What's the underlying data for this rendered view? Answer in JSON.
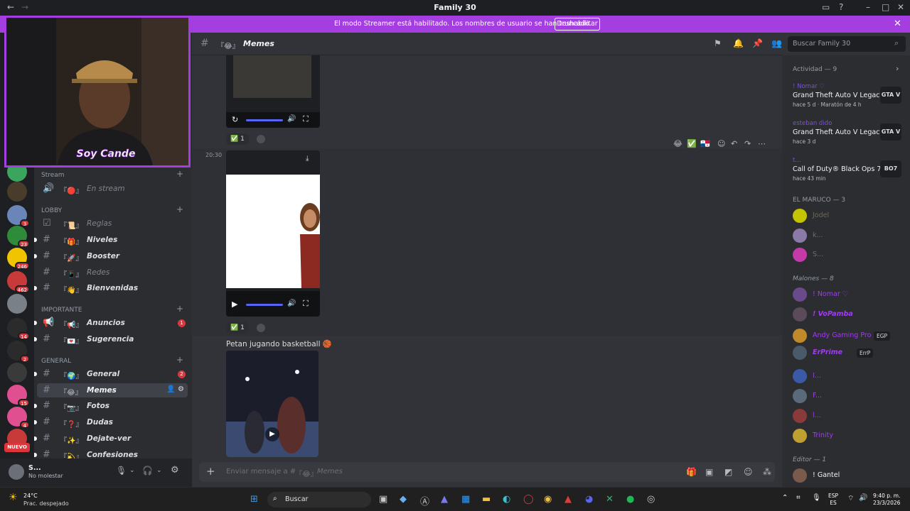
{
  "window": {
    "title": "Family 30"
  },
  "banner": {
    "message": "El modo Streamer está habilitado. Los nombres de usuario se han truncado.",
    "button": "Deshabilitar"
  },
  "server_badges": [
    "3",
    "23",
    "246",
    "462",
    "14",
    "2",
    "15",
    "4"
  ],
  "new_label": "NUEVO",
  "sidebar": {
    "categories": {
      "stream": "Stream",
      "lobby": "LOBBY",
      "importante": "IMPORTANTE",
      "general": "GENERAL"
    },
    "channels": [
      {
        "emoji": "『🔴』",
        "name": "En stream",
        "muted": true,
        "unread": ""
      },
      {
        "emoji": "『📜』",
        "name": "Reglas",
        "muted": true,
        "unread": ""
      },
      {
        "emoji": "『🎁』",
        "name": "Niveles",
        "muted": false,
        "unread": ""
      },
      {
        "emoji": "『🚀』",
        "name": "Booster",
        "muted": false,
        "unread": ""
      },
      {
        "emoji": "『📱』",
        "name": "Redes",
        "muted": true,
        "unread": ""
      },
      {
        "emoji": "『👋』",
        "name": "Bienvenidas",
        "muted": false,
        "unread": ""
      },
      {
        "emoji": "『📢』",
        "name": "Anuncios",
        "muted": false,
        "unread": "1"
      },
      {
        "emoji": "『💌』",
        "name": "Sugerencia",
        "muted": false,
        "unread": ""
      },
      {
        "emoji": "『🌍』",
        "name": "General",
        "muted": false,
        "unread": "2"
      },
      {
        "emoji": "『😂』",
        "name": "Memes",
        "muted": false,
        "unread": ""
      },
      {
        "emoji": "『📷』",
        "name": "Fotos",
        "muted": false,
        "unread": ""
      },
      {
        "emoji": "『❓』",
        "name": "Dudas",
        "muted": false,
        "unread": ""
      },
      {
        "emoji": "『✨』",
        "name": "Dejate-ver",
        "muted": false,
        "unread": ""
      },
      {
        "emoji": "『💫』",
        "name": "Confesiones",
        "muted": false,
        "unread": ""
      }
    ]
  },
  "webcam": {
    "overlay_text": "Soy Cande"
  },
  "user_panel": {
    "name": "S...",
    "status": "No molestar"
  },
  "channel_header": {
    "emoji": "『😂』",
    "name": "Memes"
  },
  "search": {
    "placeholder": "Buscar Family 30"
  },
  "messages": {
    "reaction_count_1": "1",
    "reaction_count_2": "1",
    "timestamp": "20:30",
    "caption": "Petan jugando basketball 🏀"
  },
  "composer": {
    "placeholder_prefix": "Enviar mensaje a #",
    "placeholder_emoji": "『😂』",
    "placeholder_channel": "Memes"
  },
  "members": {
    "activity_header": "Actividad — 9",
    "activities": [
      {
        "user": "! Nomar ♡",
        "game": "Grand Theft Auto V Legacy",
        "sub": "hace 5 d · Maratón de 4 h",
        "logo": "GTA V"
      },
      {
        "user": "esteban dido",
        "game": "Grand Theft Auto V Legacy",
        "sub": "hace 3 d",
        "logo": "GTA V"
      },
      {
        "user": "t...",
        "game": "Call of Duty® Black Ops 7",
        "sub": "hace 43 min",
        "logo": "BO7"
      }
    ],
    "role_el_maruco": "EL MARUCO — 3",
    "role_malones": "Malones — 8",
    "role_editor": "Editor — 1",
    "maruco_members": [
      "Jodel",
      "k...",
      "S..."
    ],
    "malones_members": [
      {
        "name": "! Nomar ♡",
        "color": "#a03cf0",
        "tag": ""
      },
      {
        "name": "! VoPamba",
        "color": "#a03cf0",
        "tag": ""
      },
      {
        "name": "Andy Gaming Pro",
        "color": "#a03cf0",
        "tag": "EGP"
      },
      {
        "name": "ErPrime",
        "color": "#a03cf0",
        "tag": "ErrP"
      },
      {
        "name": "I...",
        "color": "#a03cf0",
        "tag": ""
      },
      {
        "name": "F...",
        "color": "#a03cf0",
        "tag": ""
      },
      {
        "name": "l...",
        "color": "#a03cf0",
        "tag": ""
      },
      {
        "name": "Trinity",
        "color": "#a03cf0",
        "tag": ""
      }
    ],
    "editor_members": [
      "! Gantel"
    ]
  },
  "taskbar": {
    "temp": "24°C",
    "condition": "Prac. despejado",
    "search_label": "Buscar",
    "lang_top": "ESP",
    "lang_bottom": "ES",
    "time": "9:40 p. m.",
    "date": "23/3/2026"
  }
}
